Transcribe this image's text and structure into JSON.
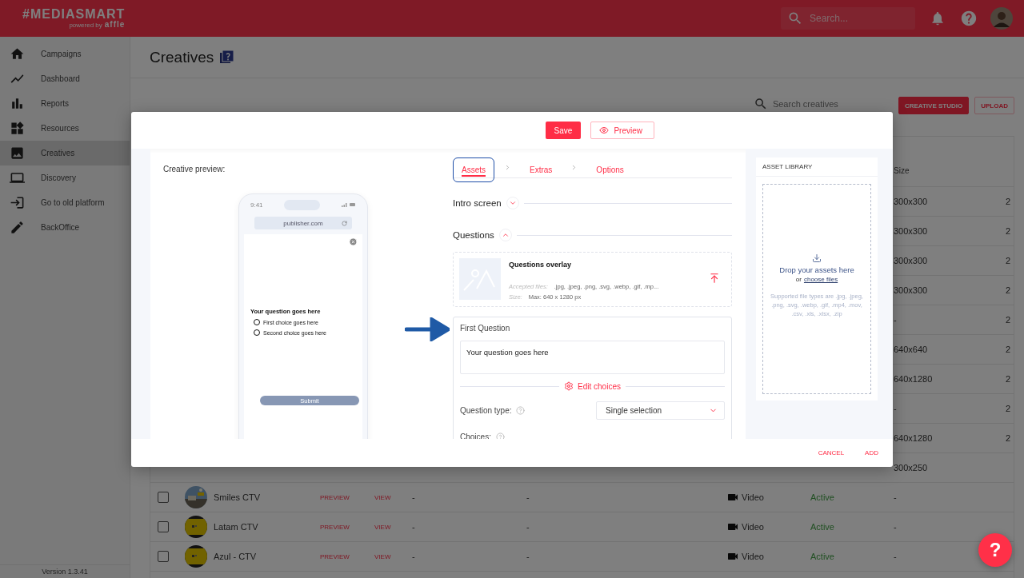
{
  "header": {
    "logo": "#MEDIASMART",
    "tagline": "powered by",
    "brand": "affle",
    "search": {
      "placeholder": "Search..."
    }
  },
  "sidebar": {
    "items": [
      {
        "label": "Campaigns",
        "selected": false
      },
      {
        "label": "Dashboard",
        "selected": false
      },
      {
        "label": "Reports",
        "selected": false
      },
      {
        "label": "Resources",
        "selected": false
      },
      {
        "label": "Creatives",
        "selected": true
      },
      {
        "label": "Discovery",
        "selected": false
      },
      {
        "label": "Go to old platform",
        "selected": false
      },
      {
        "label": "BackOffice",
        "selected": false
      }
    ],
    "version": "Version 1.3.41"
  },
  "page": {
    "title": "Creatives"
  },
  "toolbar": {
    "search": {
      "placeholder": "Search creatives"
    },
    "buttons": [
      {
        "label": "CREATIVE STUDIO",
        "kind": "primary"
      },
      {
        "label": "UPLOAD",
        "kind": "outline"
      }
    ]
  },
  "table": {
    "columns": [
      {
        "label": "Size"
      }
    ],
    "rows": [
      {
        "size": "300x300",
        "column_11": "2"
      },
      {
        "size": "300x300",
        "column_11": "2"
      },
      {
        "size": "300x300",
        "column_11": "2"
      },
      {
        "size": "300x300",
        "column_11": "2"
      },
      {
        "size": "-",
        "column_11": "2"
      },
      {
        "size": "640x640",
        "column_11": "2"
      },
      {
        "size": "640x1280",
        "column_11": "2"
      },
      {
        "size": "-",
        "column_11": "2"
      },
      {
        "size": "640x1280",
        "column_11": "2"
      },
      {
        "size": "300x250"
      },
      {
        "name": "Smiles CTV",
        "checked": false,
        "preview": "PREVIEW",
        "view": "VIEW",
        "url": "-",
        "pixel": "-",
        "type": {
          "kind": "video",
          "label": "Video"
        },
        "status": "Active",
        "size": "-"
      },
      {
        "name": "Latam CTV",
        "checked": false,
        "preview": "PREVIEW",
        "view": "VIEW",
        "url": "-",
        "pixel": "-",
        "type": {
          "kind": "video",
          "label": "Video"
        },
        "status": "Active",
        "size": "-"
      },
      {
        "name": "Azul - CTV",
        "checked": false,
        "preview": "PREVIEW",
        "view": "VIEW",
        "url": "-",
        "pixel": "-",
        "type": {
          "kind": "video",
          "label": "Video"
        },
        "status": "Active",
        "size": "-"
      }
    ]
  },
  "modal": {
    "buttons": [
      {
        "label": "Save",
        "kind": "primary"
      },
      {
        "label": "Preview",
        "kind": "outline"
      }
    ],
    "preview": {
      "label": "Creative preview:",
      "phone": {
        "time": "9:41",
        "url": "publisher.com",
        "question": "Your question goes here",
        "choices": [
          {
            "label": "First choice goes here",
            "selected": false
          },
          {
            "label": "Second choice goes here",
            "selected": false
          }
        ],
        "submit": "Submit"
      }
    },
    "steps": [
      {
        "label": "Assets",
        "selected": true,
        "highlighted": true
      },
      {
        "label": "Extras",
        "selected": false,
        "highlighted": false
      },
      {
        "label": "Options",
        "selected": false,
        "highlighted": false
      }
    ],
    "sections": [
      {
        "title": "Intro screen",
        "expanded": false
      },
      {
        "title": "Questions",
        "expanded": true,
        "asset": {
          "title": "Questions overlay",
          "accepted_label": "Accepted files:",
          "accepted": ".jpg, .jpeg, .png, .svg, .webp, .gif, .mp...",
          "size_label": "Size:",
          "size": "Max: 640 x 1280 px"
        },
        "question": {
          "title": "First Question",
          "value": "Your question goes here",
          "edit_choices": "Edit choices",
          "type_label": "Question type:",
          "type_value": "Single selection",
          "choices_label": "Choices:"
        }
      }
    ],
    "library": {
      "title": "ASSET LIBRARY",
      "drop": "Drop your assets here",
      "or": "or",
      "choose": "choose files",
      "supported": "Supported file types are .jpg, .jpeg, .png, .svg, .webp, .gif, .mp4, .mov, .csv, .xls, .xlsx, .zip"
    },
    "footer": [
      {
        "label": "CANCEL"
      },
      {
        "label": "ADD"
      }
    ]
  },
  "help_button": {
    "label": "?"
  }
}
